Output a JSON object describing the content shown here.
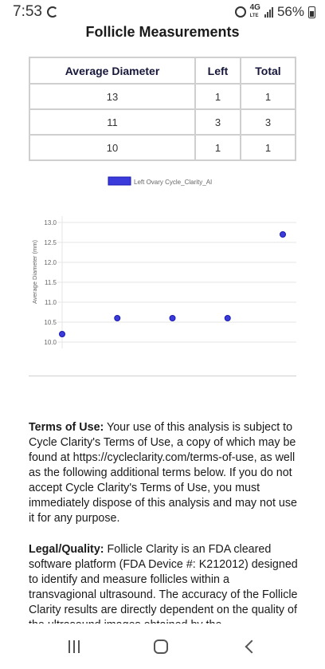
{
  "status_bar": {
    "time": "7:53",
    "network": "4G",
    "network_sub": "LTE",
    "battery": "56%"
  },
  "page_title": "Follicle Measurements",
  "table": {
    "headers": [
      "Average Diameter",
      "Left",
      "Total"
    ],
    "rows": [
      [
        "13",
        "1",
        "1"
      ],
      [
        "11",
        "3",
        "3"
      ],
      [
        "10",
        "1",
        "1"
      ]
    ]
  },
  "chart_data": {
    "type": "scatter",
    "series": [
      {
        "name": "Left Ovary Cycle_Clarity_AI",
        "color": "#3b3bdb",
        "points": [
          [
            0,
            10.2
          ],
          [
            1,
            10.6
          ],
          [
            2,
            10.6
          ],
          [
            3,
            10.6
          ],
          [
            4,
            12.7
          ]
        ]
      }
    ],
    "ylabel": "Average Diameter (mm)",
    "yticks": [
      "13.0",
      "12.5",
      "12.0",
      "11.5",
      "11.0",
      "10.5",
      "10.0"
    ],
    "ylim": [
      10.0,
      13.0
    ],
    "xlim": [
      0,
      4
    ],
    "grid": true,
    "legend": "top"
  },
  "terms": {
    "heading": "Terms of Use:",
    "body": " Your use of this analysis is subject to Cycle Clarity's Terms of Use, a copy of which may be found at https://cycleclarity.com/terms-of-use, as well as the following additional terms below. If you do not accept Cycle Clarity's Terms of Use, you must immediately dispose of this analysis and may not use it for any purpose."
  },
  "legal": {
    "heading": "Legal/Quality:",
    "body": " Follicle Clarity is an FDA cleared software platform (FDA Device #: K212012) designed to identify and measure follicles within a transvagional ultrasound. The accuracy of the Follicle Clarity results are directly dependent on the quality of the ultrasound images obtained by the"
  }
}
